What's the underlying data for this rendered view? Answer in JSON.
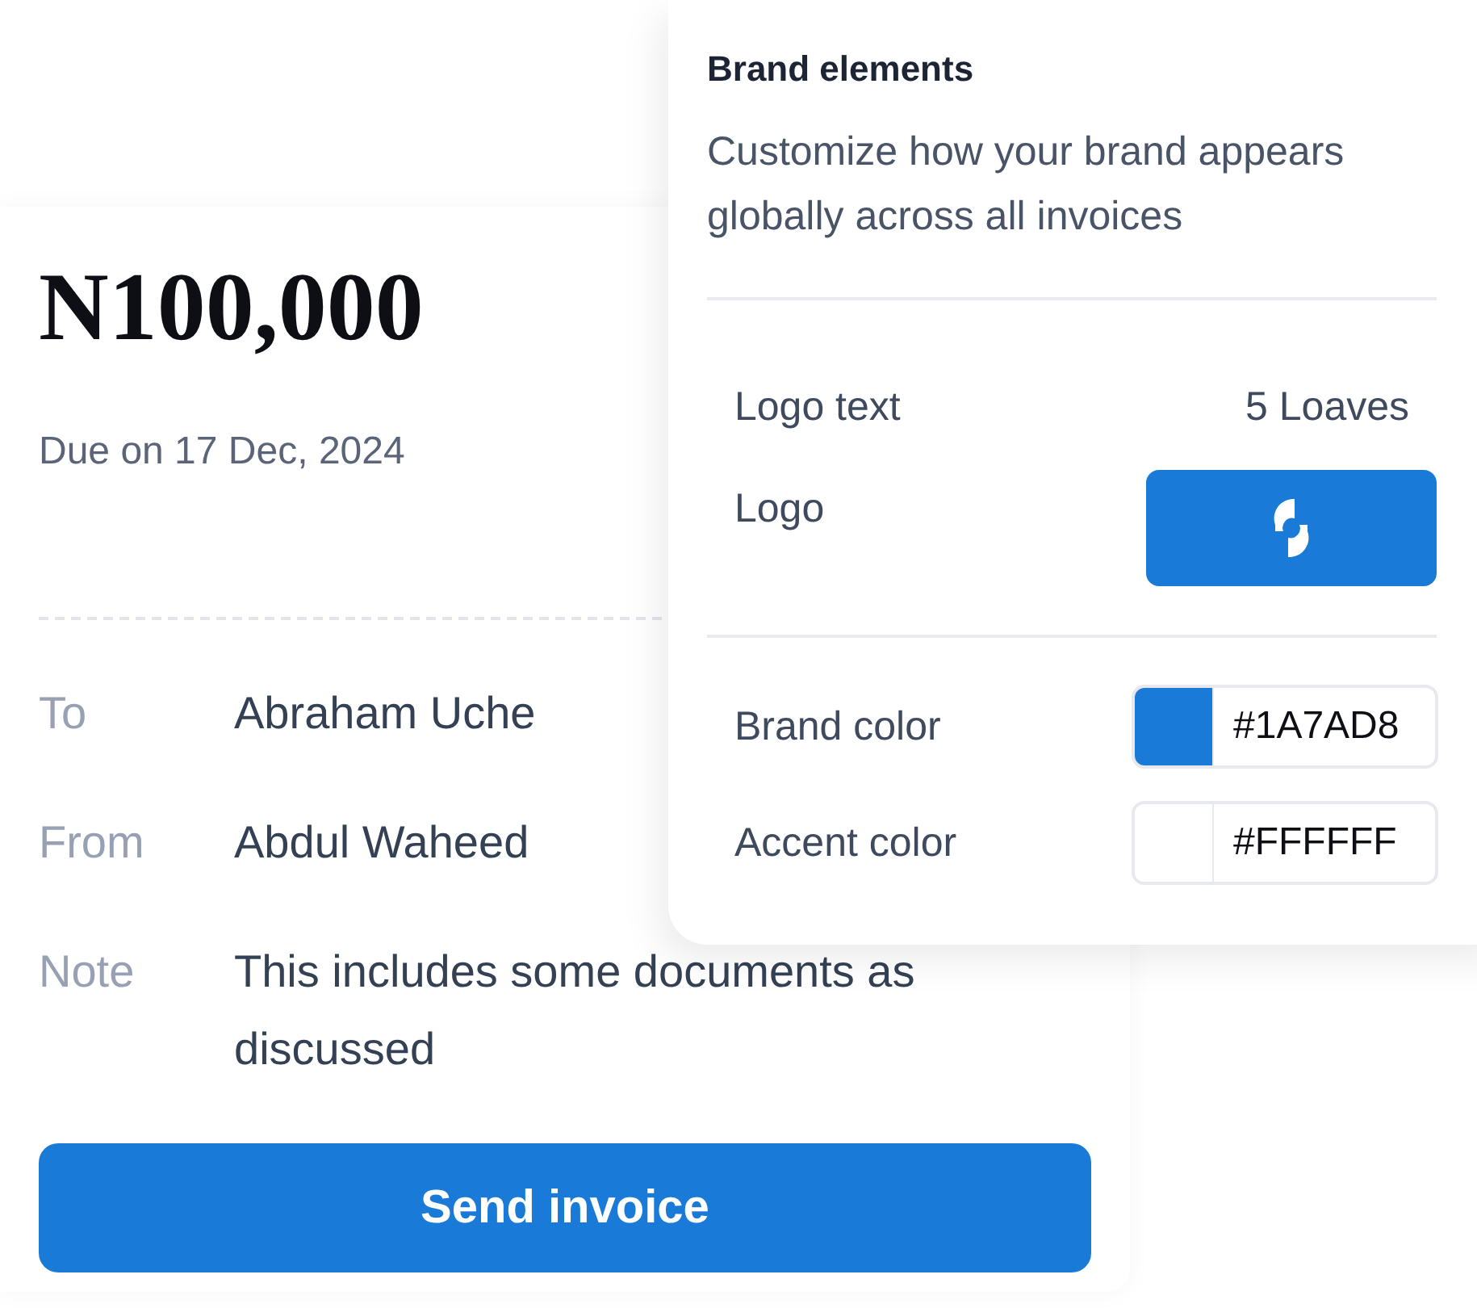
{
  "invoice": {
    "amount": "N100,000",
    "due": "Due on 17 Dec, 2024",
    "fields": [
      {
        "label": "To",
        "value": "Abraham Uche"
      },
      {
        "label": "From",
        "value": "Abdul Waheed"
      },
      {
        "label": "Note",
        "value": "This includes some documents as discussed"
      }
    ],
    "button": "Send invoice"
  },
  "brand_panel": {
    "title": "Brand elements",
    "description": "Customize how your brand appears globally across all invoices",
    "logo_text": {
      "label": "Logo text",
      "value": "5 Loaves"
    },
    "logo": {
      "label": "Logo"
    },
    "colors": [
      {
        "label": "Brand color",
        "value": "#1A7AD8",
        "color": "#1a7ad8"
      },
      {
        "label": "Accent color",
        "value": "#FFFFFF",
        "color": "#ffffff"
      }
    ]
  }
}
